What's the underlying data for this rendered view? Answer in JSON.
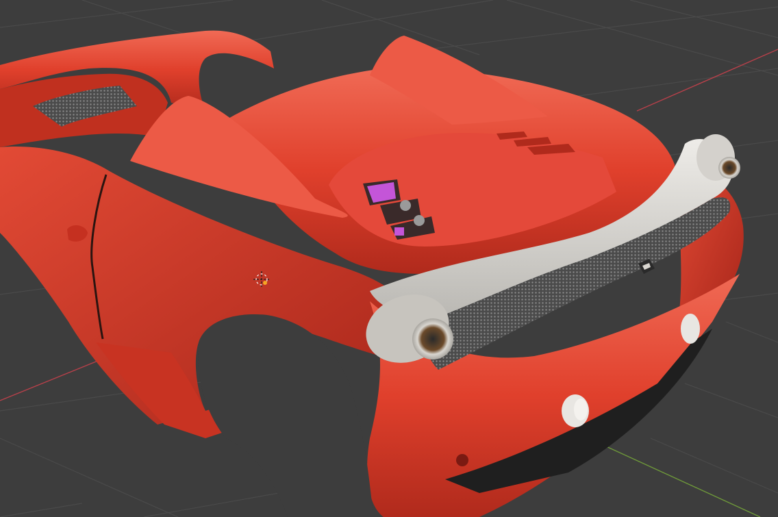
{
  "viewport": {
    "background": "#3d3d3d",
    "grid_color": "#4a4a4a",
    "x_axis_color": "#b8404a",
    "y_axis_color": "#6f9a3a"
  },
  "model": {
    "body_color": "#e0402c",
    "body_shadow": "#a8261a",
    "body_highlight": "#f06a55",
    "rear_wing_color": "#d8d6d2",
    "mesh_color": "#5a5a5a",
    "engine_accent": "#c455d8",
    "dark_parts": "#1f1f1f"
  },
  "overlay": {
    "origin_marker_icon": "object-origin-icon",
    "badge_icon": "prancing-horse-badge-icon"
  }
}
